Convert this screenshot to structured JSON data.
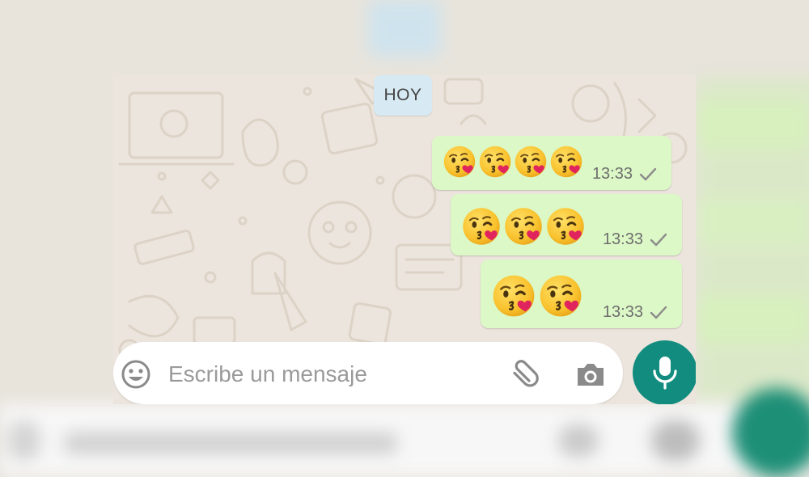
{
  "date_divider": {
    "label": "HOY"
  },
  "messages": [
    {
      "emoji": "😘",
      "emoji_count": 4,
      "time": "13:33",
      "status_icon": "single-check-icon"
    },
    {
      "emoji": "😘",
      "emoji_count": 3,
      "time": "13:33",
      "status_icon": "single-check-icon"
    },
    {
      "emoji": "😘",
      "emoji_count": 2,
      "time": "13:33",
      "status_icon": "single-check-icon"
    }
  ],
  "composer": {
    "placeholder": "Escribe un mensaje",
    "emoji_icon": "smiley-icon",
    "attach_icon": "paperclip-icon",
    "camera_icon": "camera-icon",
    "send_icon": "microphone-icon"
  },
  "colors": {
    "chat_background": "#ece5dd",
    "outgoing_bubble": "#dcf8c6",
    "date_pill": "#d7eaf3",
    "accent": "#128c7e"
  }
}
